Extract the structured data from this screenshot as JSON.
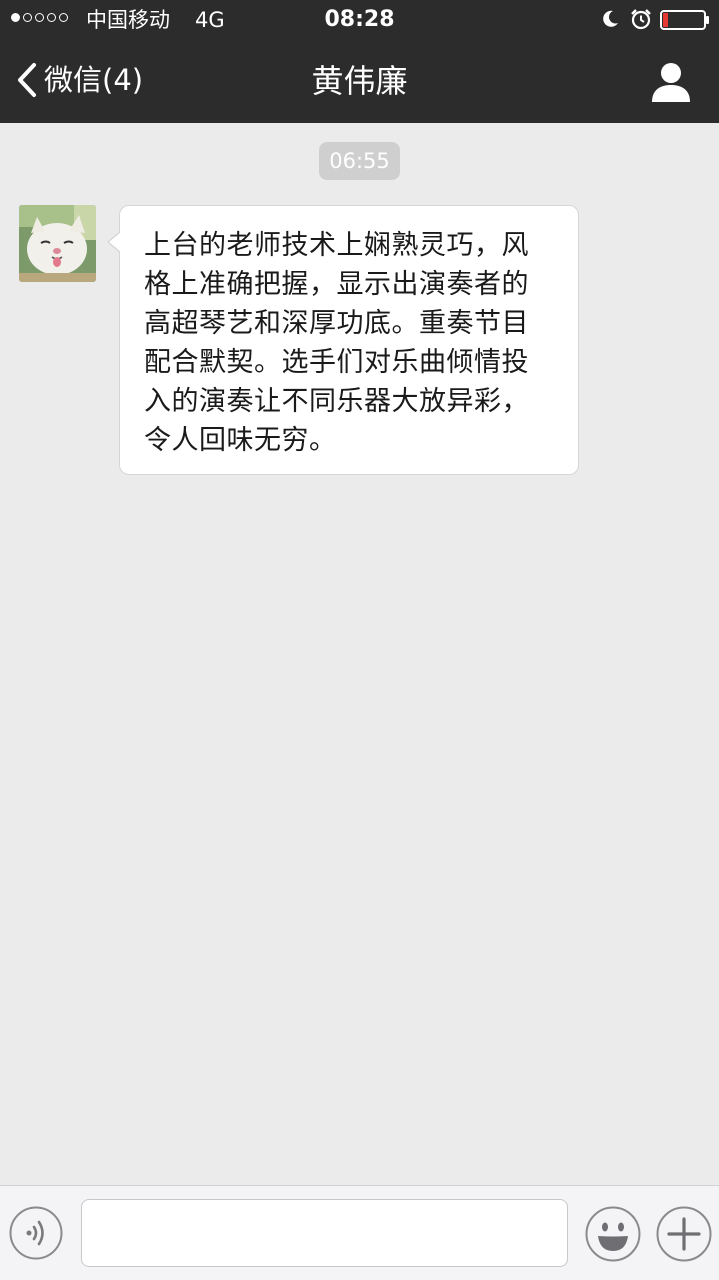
{
  "status_bar": {
    "carrier": "中国移动",
    "network": "4G",
    "time": "08:28",
    "signal_strength": 1,
    "signal_max": 5,
    "battery_level": 0.12,
    "battery_color": "#e53935",
    "icons": [
      "moon-icon",
      "alarm-icon",
      "battery-icon"
    ]
  },
  "nav": {
    "back_label": "微信(4)",
    "title": "黄伟廉",
    "profile_icon": "person-icon"
  },
  "chat": {
    "timestamp": "06:55",
    "messages": [
      {
        "direction": "incoming",
        "avatar": "cat-avatar",
        "text": "上台的老师技术上娴熟灵巧，风格上准确把握，显示出演奏者的高超琴艺和深厚功底。重奏节目配合默契。选手们对乐曲倾情投入的演奏让不同乐器大放异彩，令人回味无穷。"
      }
    ]
  },
  "input_bar": {
    "input_value": "",
    "icons": [
      "voice-icon",
      "emoji-icon",
      "plus-icon"
    ]
  },
  "colors": {
    "header_bg": "#2c2c2d",
    "chat_bg": "#ebebeb",
    "bubble_bg": "#ffffff",
    "timestamp_bg": "#cfcfcf"
  }
}
